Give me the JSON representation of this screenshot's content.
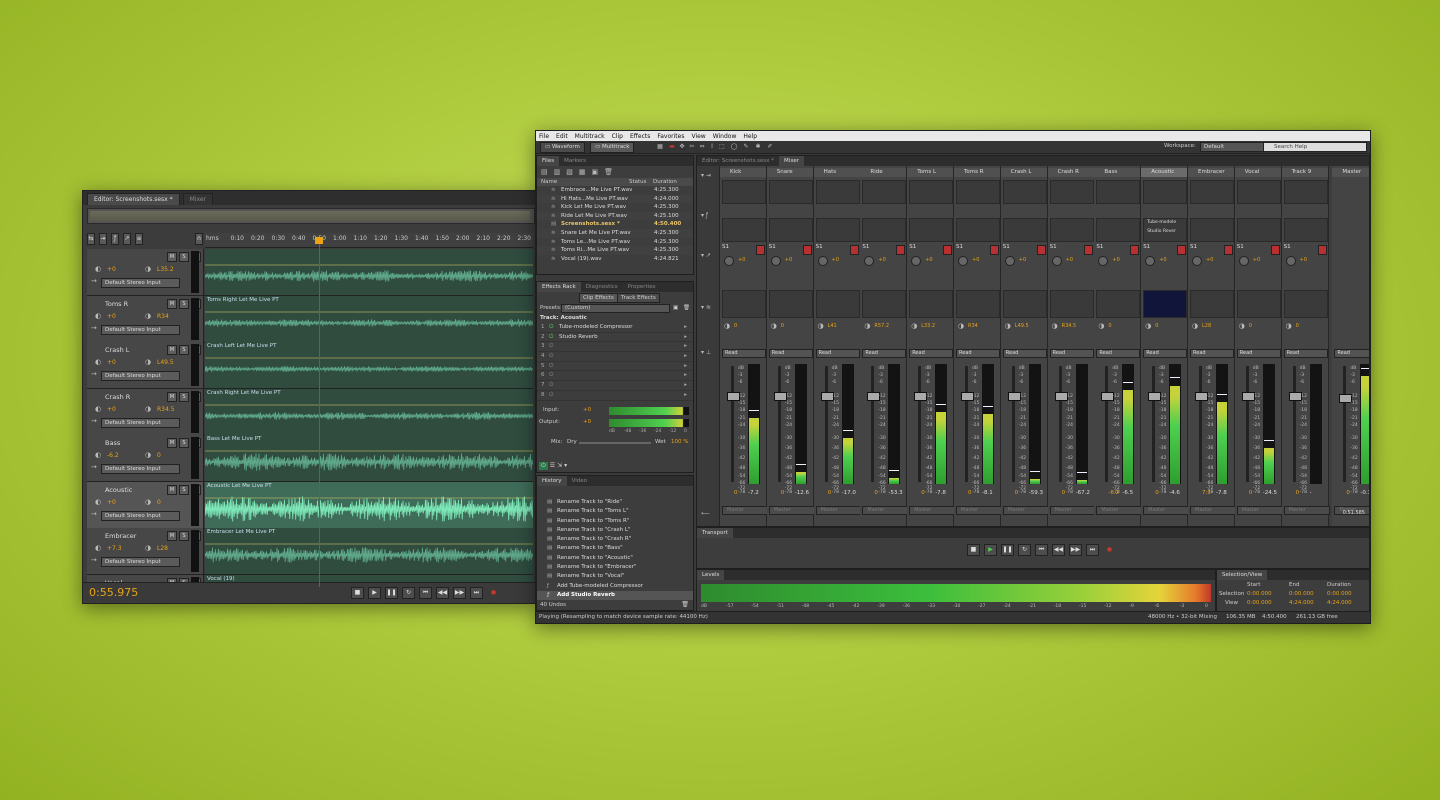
{
  "editor_window": {
    "tabs": [
      "Editor: Screenshots.sesx *",
      "Mixer"
    ],
    "ruler_ticks": [
      "hms",
      "0:10",
      "0:20",
      "0:30",
      "0:40",
      "0:50",
      "1:00",
      "1:10",
      "1:20",
      "1:30",
      "1:40",
      "1:50",
      "2:00",
      "2:10",
      "2:20",
      "2:30"
    ],
    "tracks": [
      {
        "name": "",
        "vol": "+0",
        "pan": "L35.2",
        "input": "Default Stereo Input",
        "clip": ""
      },
      {
        "name": "Toms R",
        "vol": "+0",
        "pan": "R34",
        "input": "Default Stereo Input",
        "clip": "Toms Right Let Me Live PT"
      },
      {
        "name": "Crash L",
        "vol": "+0",
        "pan": "L49.5",
        "input": "Default Stereo Input",
        "clip": "Crash Left Let Me Live PT"
      },
      {
        "name": "Crash R",
        "vol": "+0",
        "pan": "R34.5",
        "input": "Default Stereo Input",
        "clip": "Crash Right Let Me Live PT"
      },
      {
        "name": "Bass",
        "vol": "-6.2",
        "pan": "0",
        "input": "Default Stereo Input",
        "clip": "Bass Let Me Live PT"
      },
      {
        "name": "Acoustic",
        "vol": "+0",
        "pan": "0",
        "input": "Default Stereo Input",
        "clip": "Acoustic Let Me Live PT"
      },
      {
        "name": "Embracer",
        "vol": "+7.3",
        "pan": "L28",
        "input": "Default Stereo Input",
        "clip": "Embracer Let Me Live PT"
      },
      {
        "name": "Vocal",
        "vol": "+0",
        "pan": "0",
        "input": "",
        "clip": "Vocal (19)"
      }
    ],
    "timecode": "0:55.975"
  },
  "main_window": {
    "menu": [
      "File",
      "Edit",
      "Multitrack",
      "Clip",
      "Effects",
      "Favorites",
      "View",
      "Window",
      "Help"
    ],
    "modes": [
      "Waveform",
      "Multitrack"
    ],
    "workspace_label": "Workspace:",
    "workspace_value": "Default",
    "search_placeholder": "Search Help",
    "files_panel": {
      "tabs": [
        "Files",
        "Markers"
      ],
      "columns": [
        "Name",
        "Status",
        "Duration"
      ],
      "rows": [
        {
          "name": "Embrace...Me Live PT.wav",
          "dur": "4:25.300"
        },
        {
          "name": "Hi Hats...Me Live PT.wav",
          "dur": "4:24.000"
        },
        {
          "name": "Kick Let Me Live PT.wav",
          "dur": "4:25.300"
        },
        {
          "name": "Ride Let Me Live PT.wav",
          "dur": "4:25.100"
        },
        {
          "name": "Screenshots.sesx *",
          "dur": "4:50.400"
        },
        {
          "name": "Snare Let Me Live PT.wav",
          "dur": "4:25.300"
        },
        {
          "name": "Toms Le...Me Live PT.wav",
          "dur": "4:25.300"
        },
        {
          "name": "Toms Ri...Me Live PT.wav",
          "dur": "4:25.300"
        },
        {
          "name": "Vocal (19).wav",
          "dur": "4:24.821"
        }
      ]
    },
    "effects_panel": {
      "tabs": [
        "Effects Rack",
        "Diagnostics",
        "Properties"
      ],
      "subtabs": [
        "Clip Effects",
        "Track Effects"
      ],
      "presets_label": "Presets:",
      "presets_value": "(Custom)",
      "track_label": "Track: Acoustic",
      "slots": [
        {
          "n": "1",
          "name": "Tube-modeled Compressor"
        },
        {
          "n": "2",
          "name": "Studio Reverb"
        },
        {
          "n": "3",
          "name": ""
        },
        {
          "n": "4",
          "name": ""
        },
        {
          "n": "5",
          "name": ""
        },
        {
          "n": "6",
          "name": ""
        },
        {
          "n": "7",
          "name": ""
        },
        {
          "n": "8",
          "name": ""
        }
      ],
      "input_label": "Input:",
      "input_value": "+0",
      "output_label": "Output:",
      "output_value": "+0",
      "io_scale": [
        "dB",
        "-48",
        "-36",
        "-24",
        "-12",
        "0"
      ],
      "mix_label": "Mix:",
      "dry_label": "Dry",
      "wet_label": "Wet",
      "mix_value": "100 %"
    },
    "history_panel": {
      "tabs": [
        "History",
        "Video"
      ],
      "items": [
        "Rename Track to \"Ride\"",
        "Rename Track to \"Toms L\"",
        "Rename Track to \"Toms R\"",
        "Rename Track to \"Crash L\"",
        "Rename Track to \"Crash R\"",
        "Rename Track to \"Bass\"",
        "Rename Track to \"Acoustic\"",
        "Rename Track to \"Embracer\"",
        "Rename Track to \"Vocal\"",
        "Add Tube-modeled Compressor",
        "Add Studio Reverb"
      ],
      "undo_count": "40 Undos"
    },
    "mixer": {
      "tabs": [
        "Editor: Screenshots.sesx *",
        "Mixer"
      ],
      "strips": [
        {
          "name": "Kick",
          "vol": "0",
          "peak": "-7.2",
          "pan": "0",
          "send": "+0",
          "level": 0.55,
          "selected": false
        },
        {
          "name": "Snare",
          "vol": "0",
          "peak": "-12.6",
          "pan": "0",
          "send": "+0",
          "level": 0.1,
          "selected": false
        },
        {
          "name": "Hats",
          "vol": "0",
          "peak": "-17.0",
          "pan": "L41",
          "send": "+0",
          "level": 0.38,
          "selected": false
        },
        {
          "name": "Ride",
          "vol": "0",
          "peak": "-53.3",
          "pan": "R57.2",
          "send": "+0",
          "level": 0.05,
          "selected": false
        },
        {
          "name": "Toms L",
          "vol": "0",
          "peak": "-7.8",
          "pan": "L33.2",
          "send": "+0",
          "level": 0.6,
          "selected": false
        },
        {
          "name": "Toms R",
          "vol": "0",
          "peak": "-8.1",
          "pan": "R34",
          "send": "+0",
          "level": 0.58,
          "selected": false
        },
        {
          "name": "Crash L",
          "vol": "0",
          "peak": "-59.3",
          "pan": "L49.5",
          "send": "+0",
          "level": 0.04,
          "selected": false
        },
        {
          "name": "Crash R",
          "vol": "0",
          "peak": "-67.2",
          "pan": "R34.5",
          "send": "+0",
          "level": 0.03,
          "selected": false
        },
        {
          "name": "Bass",
          "vol": "-6.2",
          "peak": "-6.5",
          "pan": "0",
          "send": "+0",
          "level": 0.78,
          "selected": false
        },
        {
          "name": "Acoustic",
          "vol": "0",
          "peak": "-4.6",
          "pan": "0",
          "send": "+0",
          "level": 0.82,
          "selected": true
        },
        {
          "name": "Embracer",
          "vol": "7.3",
          "peak": "-7.8",
          "pan": "L28",
          "send": "+0",
          "level": 0.68,
          "selected": false
        },
        {
          "name": "Vocal",
          "vol": "0",
          "peak": "-24.5",
          "pan": "0",
          "send": "+0",
          "level": 0.3,
          "selected": false
        },
        {
          "name": "Track 9",
          "vol": "0",
          "peak": "-",
          "pan": "0",
          "send": "+0",
          "level": 0.0,
          "selected": false
        }
      ],
      "master": {
        "name": "Master",
        "vol": "0",
        "peak": "-0.3",
        "level": 0.9
      },
      "fx_slots": [
        "Tube-modele",
        "Studio Rever"
      ],
      "automation_value": "Read",
      "output_value": "Master",
      "fader_scale": [
        "dB",
        "-3",
        "-6",
        "-12",
        "-15",
        "-18",
        "-21",
        "-24",
        "-30",
        "-36",
        "-42",
        "-48",
        "-54",
        "-66",
        "-72",
        "-78"
      ],
      "time_readout": "0:51.585"
    },
    "transport_label": "Transport",
    "levels": {
      "label": "Levels",
      "scale": [
        "dB",
        "-57",
        "-54",
        "-51",
        "-48",
        "-45",
        "-42",
        "-39",
        "-36",
        "-33",
        "-30",
        "-27",
        "-24",
        "-21",
        "-18",
        "-15",
        "-12",
        "-9",
        "-6",
        "-3",
        "0"
      ]
    },
    "selection_view": {
      "tabs": [
        "Selection/View"
      ],
      "headers": [
        "Start",
        "End",
        "Duration"
      ],
      "selection": {
        "label": "Selection",
        "start": "0:00.000",
        "end": "0:00.000",
        "dur": "0:00.000"
      },
      "view": {
        "label": "View",
        "start": "0:00.000",
        "end": "4:24.000",
        "dur": "4:24.000"
      }
    },
    "status": {
      "left": "Playing (Resampling to match device sample rate: 44100 Hz)",
      "sample": "48000 Hz • 32-bit Mixing",
      "mem": "106.35 MB",
      "dur": "4:50.400",
      "free": "261.13 GB free"
    }
  }
}
